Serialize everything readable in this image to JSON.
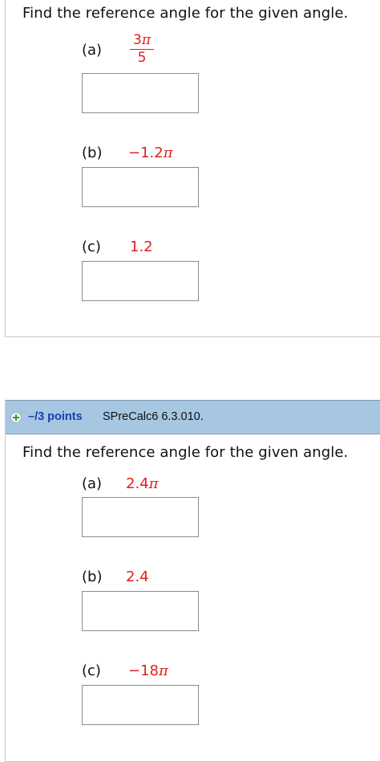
{
  "question1": {
    "prompt": "Find the reference angle for the given angle.",
    "parts": [
      {
        "label": "(a)",
        "numerator": "3",
        "pi": "π",
        "denominator": "5"
      },
      {
        "label": "(b)",
        "value": "−1.2",
        "pi": "π"
      },
      {
        "label": "(c)",
        "value": "1.2"
      }
    ]
  },
  "question2": {
    "header": {
      "points": "–/3 points",
      "source": "SPreCalc6 6.3.010."
    },
    "prompt": "Find the reference angle for the given angle.",
    "parts": [
      {
        "label": "(a)",
        "value": "2.4",
        "pi": "π"
      },
      {
        "label": "(b)",
        "value": "2.4"
      },
      {
        "label": "(c)",
        "value": "−18",
        "pi": "π"
      }
    ]
  },
  "colors": {
    "header_bg": "#a7c6e2",
    "points_text": "#1a3fb0",
    "value_text": "#e0201a",
    "plus_icon": "#2f9a3a"
  }
}
